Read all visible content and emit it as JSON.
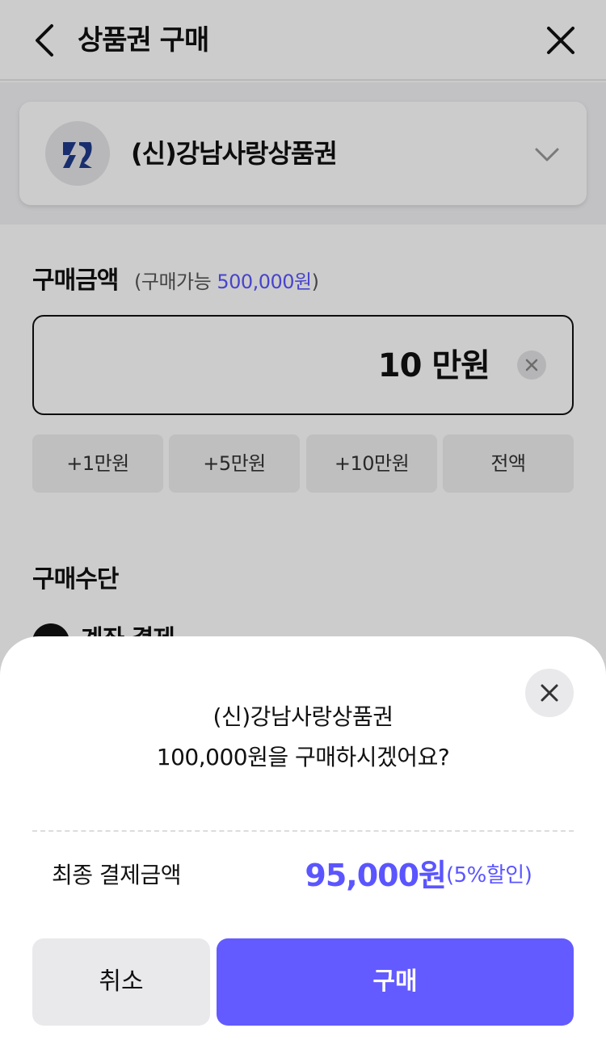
{
  "header": {
    "title": "상품권 구매"
  },
  "product": {
    "name": "(신)강남사랑상품권"
  },
  "amount": {
    "label": "구매금액",
    "sub_prefix": "(구매가능 ",
    "limit": "500,000원",
    "sub_suffix": ")",
    "value": "10 만원"
  },
  "quick_buttons": [
    "+1만원",
    "+5만원",
    "+10만원",
    "전액"
  ],
  "payment": {
    "label": "구매수단",
    "method": "계좌 결제"
  },
  "sheet": {
    "line1": "(신)강남사랑상품권",
    "line2": "100,000원을 구매하시겠어요?",
    "final_label": "최종 결제금액",
    "final_price": "95,000원",
    "final_discount": "(5%할인)",
    "cancel_label": "취소",
    "buy_label": "구매"
  },
  "colors": {
    "accent": "#635bff",
    "accent_text": "#5b55ff"
  }
}
